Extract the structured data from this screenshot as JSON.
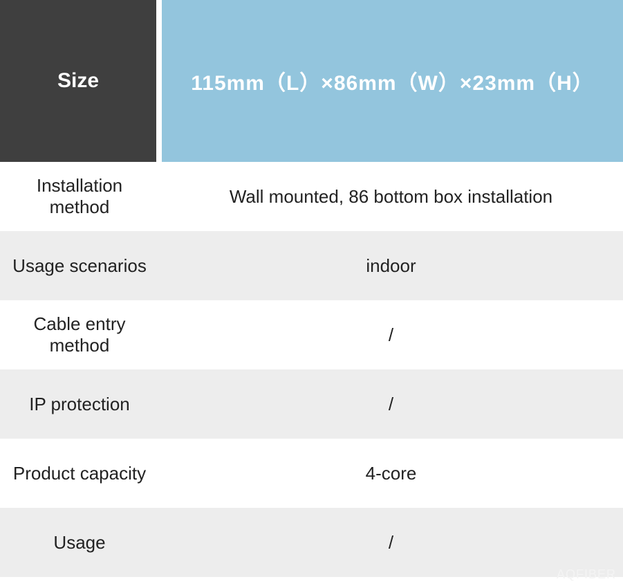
{
  "header": {
    "label": "Size",
    "value": "115mm（L）×86mm（W）×23mm（H）"
  },
  "rows": [
    {
      "label": "Installation method",
      "value": "Wall mounted, 86 bottom box installation"
    },
    {
      "label": "Usage scenarios",
      "value": "indoor"
    },
    {
      "label": "Cable entry method",
      "value": "/"
    },
    {
      "label": "IP protection",
      "value": "/"
    },
    {
      "label": "Product capacity",
      "value": "4-core"
    },
    {
      "label": "Usage",
      "value": "/"
    }
  ],
  "watermark": "AQFIBER"
}
